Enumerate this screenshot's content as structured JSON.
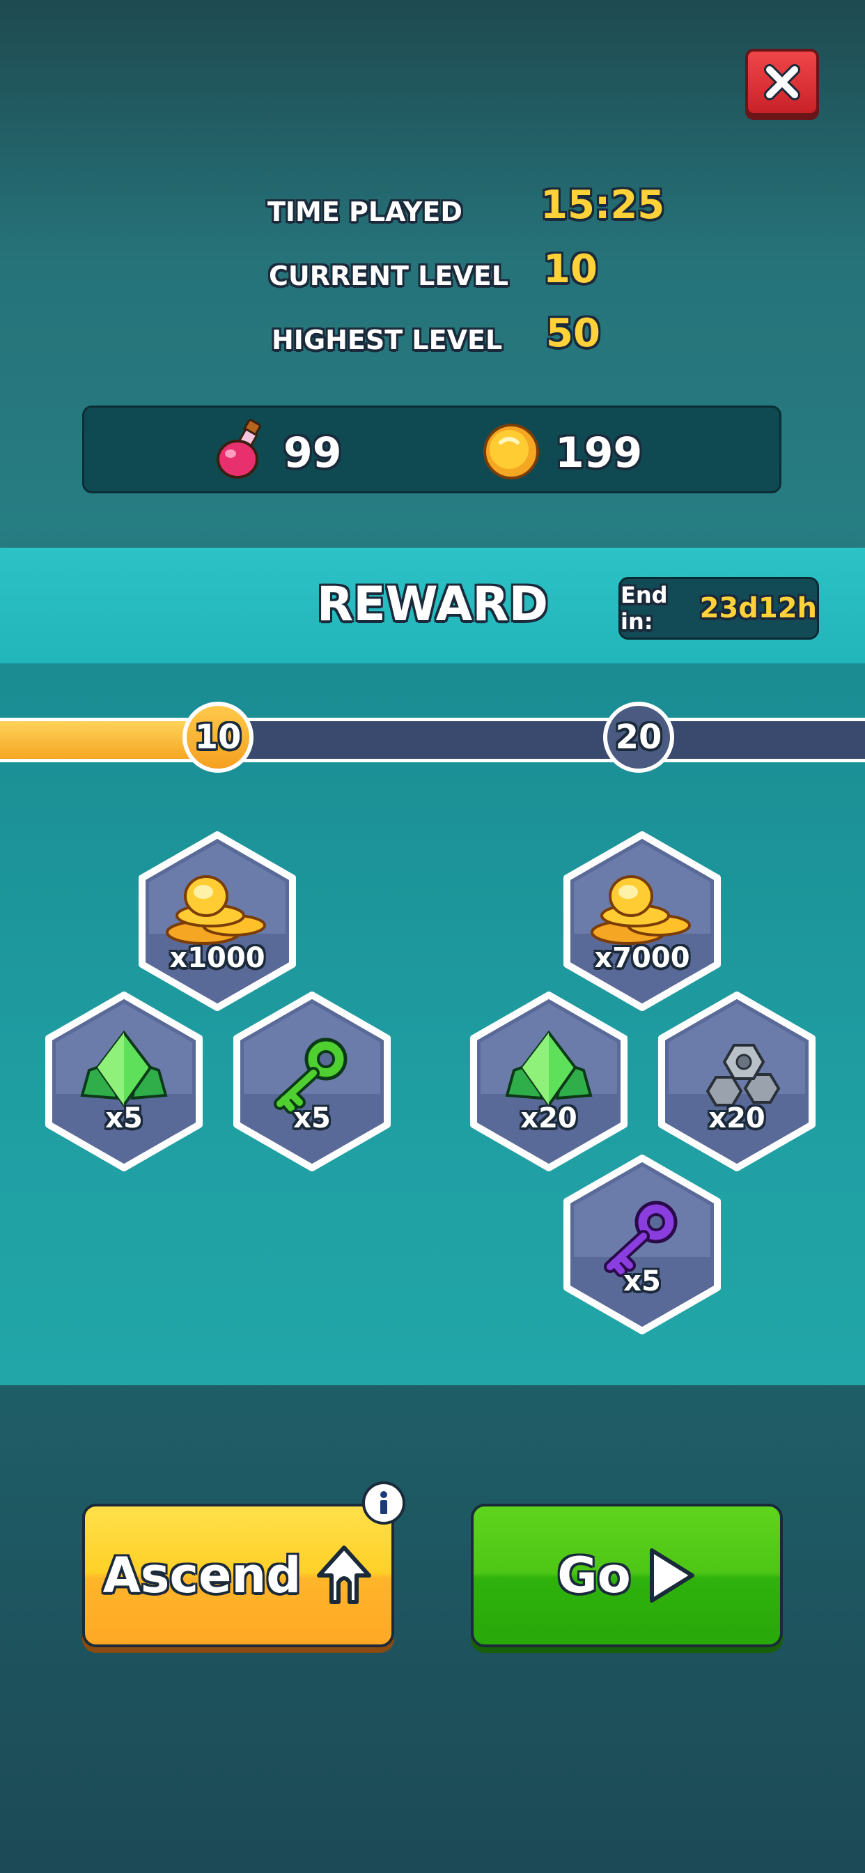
{
  "stats": [
    {
      "label": "TIME PLAYED",
      "value": "15:25"
    },
    {
      "label": "CURRENT LEVEL",
      "value": "10"
    },
    {
      "label": "HIGHEST LEVEL",
      "value": "50"
    }
  ],
  "currency": {
    "potion": "99",
    "coins": "199"
  },
  "reward": {
    "title": "REWARD",
    "end_label": "End in:",
    "end_value": "23d12h"
  },
  "progress": {
    "milestones": [
      "10",
      "20"
    ],
    "current_fraction": 0.25
  },
  "rewards": {
    "tier_10": {
      "coins": "x1000",
      "gems": "x5",
      "green_key": "x5"
    },
    "tier_20": {
      "coins": "x7000",
      "gems": "x20",
      "nuts": "x20",
      "purple_key": "x5"
    }
  },
  "buttons": {
    "ascend": "Ascend",
    "go": "Go"
  },
  "colors": {
    "gold": "#ffd23a",
    "ascend": "#ffc02a",
    "go": "#44c012",
    "close": "#e0383c",
    "track": "#3a4a6e"
  },
  "icons": [
    "close-icon",
    "potion-icon",
    "coin-icon",
    "gem-icon",
    "key-icon",
    "nut-icon",
    "ascend-arrow-icon",
    "play-icon",
    "info-icon"
  ]
}
